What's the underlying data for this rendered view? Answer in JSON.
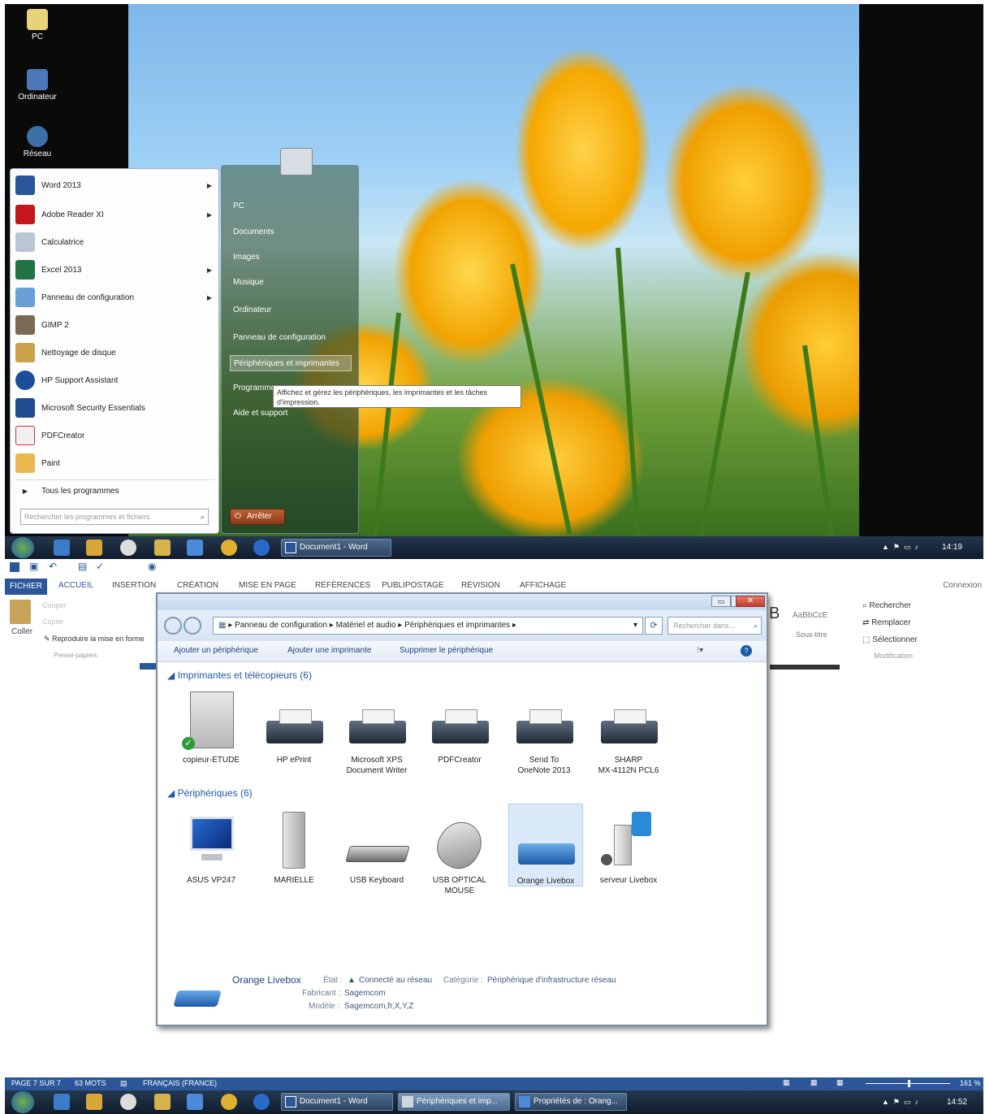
{
  "desktop": {
    "icons": [
      {
        "label": "PC"
      },
      {
        "label": "Ordinateur"
      },
      {
        "label": "Réseau"
      }
    ]
  },
  "start_menu": {
    "left_items": [
      {
        "label": "Word 2013",
        "has_arrow": true,
        "icon": "word-icon"
      },
      {
        "label": "Adobe Reader XI",
        "has_arrow": true,
        "icon": "pdf-icon"
      },
      {
        "label": "Calculatrice",
        "has_arrow": false,
        "icon": "calculator-icon"
      },
      {
        "label": "Excel 2013",
        "has_arrow": true,
        "icon": "excel-icon"
      },
      {
        "label": "Panneau de configuration",
        "has_arrow": true,
        "icon": "control-panel-icon"
      },
      {
        "label": "GIMP 2",
        "has_arrow": false,
        "icon": "gimp-icon"
      },
      {
        "label": "Nettoyage de disque",
        "has_arrow": false,
        "icon": "disk-cleanup-icon"
      },
      {
        "label": "HP Support Assistant",
        "has_arrow": false,
        "icon": "help-icon"
      },
      {
        "label": "Microsoft Security Essentials",
        "has_arrow": false,
        "icon": "security-icon"
      },
      {
        "label": "PDFCreator",
        "has_arrow": false,
        "icon": "pdfcreator-icon"
      },
      {
        "label": "Paint",
        "has_arrow": false,
        "icon": "paint-icon"
      }
    ],
    "all_programs": "Tous les programmes",
    "search_placeholder": "Rechercher les programmes et fichiers",
    "right_items": [
      "PC",
      "Documents",
      "Images",
      "Musique",
      "Ordinateur",
      "Panneau de configuration",
      "Périphériques et imprimantes",
      "Programmes",
      "Aide et support"
    ],
    "tooltip": "Affichez et gérez les périphériques, les imprimantes et les tâches d'impression.",
    "shutdown": "Arrêter"
  },
  "taskbar_top": {
    "word_button": "Document1 - Word",
    "clock": "14:19"
  },
  "word": {
    "tabs": [
      "FICHIER",
      "ACCUEIL",
      "INSERTION",
      "CRÉATION",
      "MISE EN PAGE",
      "RÉFÉRENCES",
      "PUBLIPOSTAGE",
      "RÉVISION",
      "AFFICHAGE"
    ],
    "connexion": "Connexion",
    "clipboard": {
      "paste": "Coller",
      "cut": "Couper",
      "copy": "Copier",
      "format_painter": "Reproduire la mise en forme",
      "group": "Presse-papiers"
    },
    "styles": {
      "sample": "AaBbCcE",
      "subtitle": "Sous-titre"
    },
    "editing": {
      "find": "Rechercher",
      "replace": "Remplacer",
      "select": "Sélectionner",
      "group": "Modification"
    },
    "status": {
      "page": "PAGE 7 SUR 7",
      "words": "63 MOTS",
      "language": "FRANÇAIS (FRANCE)",
      "zoom": "161 %"
    }
  },
  "explorer": {
    "breadcrumbs": [
      "Panneau de configuration",
      "Matériel et audio",
      "Périphériques et imprimantes"
    ],
    "search_placeholder": "Rechercher dans...",
    "commands": [
      "Ajouter un périphérique",
      "Ajouter une imprimante",
      "Supprimer le périphérique"
    ],
    "printers_header": "Imprimantes et télécopieurs (6)",
    "printers": [
      {
        "name": "copieur-ETUDE",
        "line2": ""
      },
      {
        "name": "HP ePrint",
        "line2": ""
      },
      {
        "name": "Microsoft XPS",
        "line2": "Document Writer"
      },
      {
        "name": "PDFCreator",
        "line2": ""
      },
      {
        "name": "Send To",
        "line2": "OneNote 2013"
      },
      {
        "name": "SHARP",
        "line2": "MX-4112N PCL6"
      }
    ],
    "devices_header": "Périphériques (6)",
    "devices": [
      {
        "name": "ASUS VP247",
        "line2": ""
      },
      {
        "name": "MARIELLE",
        "line2": ""
      },
      {
        "name": "USB Keyboard",
        "line2": ""
      },
      {
        "name": "USB OPTICAL",
        "line2": "MOUSE"
      },
      {
        "name": "Orange Livebox",
        "line2": ""
      },
      {
        "name": "serveur Livebox",
        "line2": ""
      }
    ],
    "details": {
      "name": "Orange Livebox",
      "state_label": "État :",
      "state_value": "Connecté au réseau",
      "category_label": "Catégorie :",
      "category_value": "Périphérique d'infrastructure réseau",
      "manufacturer_label": "Fabricant :",
      "manufacturer_value": "Sagemcom",
      "model_label": "Modèle :",
      "model_value": "Sagemcom,fr,X,Y,Z"
    }
  },
  "taskbar_bottom": {
    "buttons": [
      "Document1 - Word",
      "Périphériques et imp...",
      "Propriétés de : Orang..."
    ],
    "clock": "14:52"
  },
  "colors": {
    "accent": "#2b579a",
    "link": "#1e5aa8",
    "taskbar": "#1a2a3e"
  }
}
